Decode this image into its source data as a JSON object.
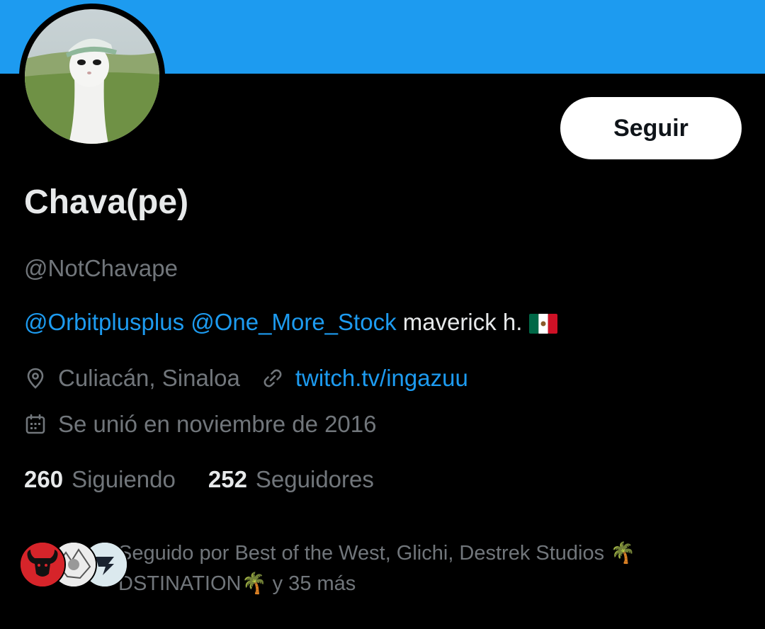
{
  "profile": {
    "display_name": "Chava(pe)",
    "handle": "@NotChavape",
    "follow_label": "Seguir",
    "bio": {
      "mention_1": "@Orbitplusplus",
      "mention_2": "@One_More_Stock",
      "text": "maverick h.",
      "flag": "🇲🇽"
    },
    "location": "Culiacán, Sinaloa",
    "website": "twitch.tv/ingazuu",
    "joined": "Se unió en noviembre de 2016",
    "following_count": "260",
    "following_label": "Siguiendo",
    "followers_count": "252",
    "followers_label": "Seguidores",
    "followed_by": "Seguido por Best of the West, Glichi, Destrek Studios 🌴 DSTINATION🌴 y 35 más"
  },
  "icons": {
    "location": "location-pin-icon",
    "link": "link-icon",
    "calendar": "calendar-icon"
  },
  "colors": {
    "banner": "#1d9bf0",
    "background": "#000000",
    "accent": "#1d9bf0",
    "primary_text": "#e7e9ea",
    "secondary_text": "#71767b"
  }
}
